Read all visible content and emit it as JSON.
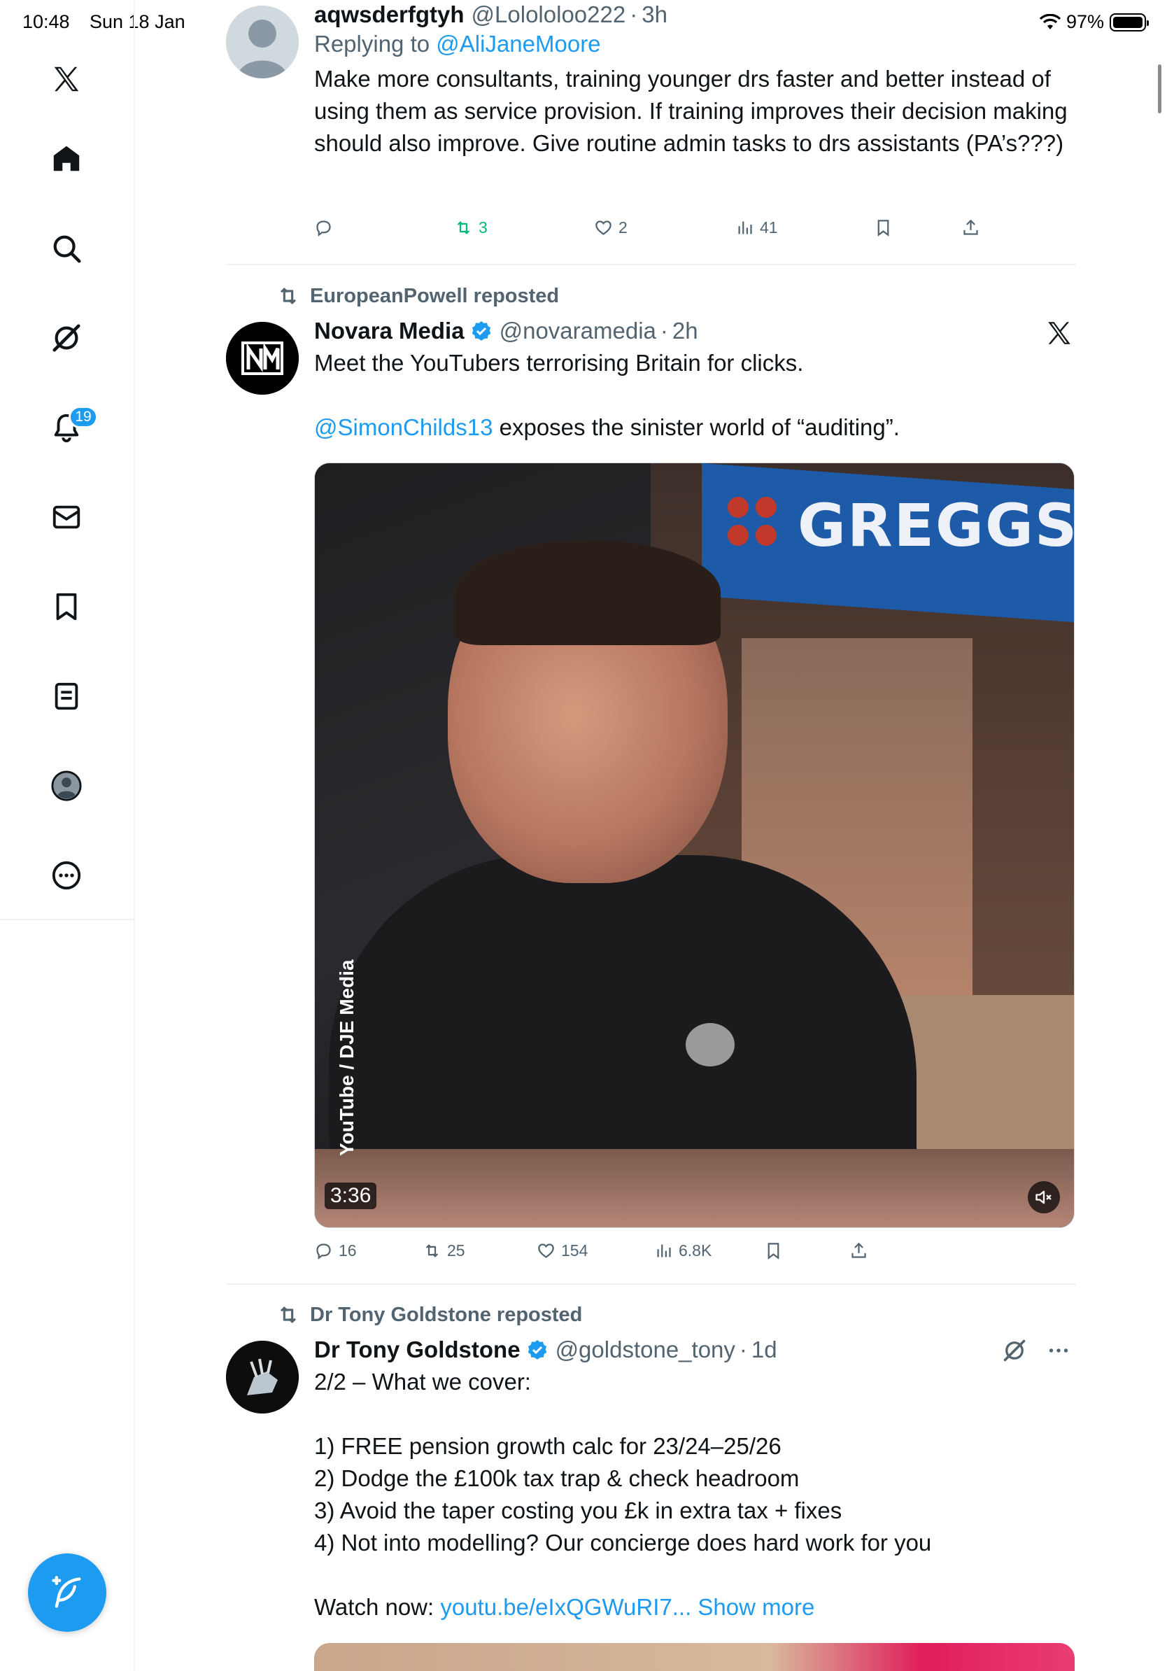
{
  "status_bar": {
    "time": "10:48",
    "date": "Sun 18 Jan",
    "battery": "97%"
  },
  "sidebar": {
    "items": [
      {
        "name": "x-logo-icon"
      },
      {
        "name": "home-icon"
      },
      {
        "name": "search-icon"
      },
      {
        "name": "grok-icon"
      },
      {
        "name": "notifications-icon",
        "badge": "19"
      },
      {
        "name": "messages-icon"
      },
      {
        "name": "bookmarks-icon"
      },
      {
        "name": "lists-icon"
      },
      {
        "name": "profile-avatar-icon"
      },
      {
        "name": "more-icon"
      }
    ],
    "compose_icon": "compose-feather-icon"
  },
  "tweets": [
    {
      "name": "aqwsderfgtyh",
      "handle": "@Lolololoo222",
      "time": "3h",
      "reply_prefix": "Replying to ",
      "reply_to": "@AliJaneMoore",
      "text": "Make more consultants, training younger drs faster and better instead of using them as service provision. If training improves their decision making should also improve. Give routine admin tasks to drs assistants (PA’s???)",
      "stats": {
        "replies": "",
        "reposts": "3",
        "likes": "2",
        "views": "41"
      }
    },
    {
      "reposted_by": "EuropeanPowell reposted",
      "name": "Novara Media",
      "handle": "@novaramedia",
      "time": "2h",
      "text_line1": "Meet the YouTubers terrorising Britain for clicks.",
      "mention": "@SimonChilds13",
      "text_line2": " exposes the sinister world of “auditing”.",
      "video": {
        "sign": "GREGGS",
        "credit": "YouTube / DJE Media",
        "duration": "3:36"
      },
      "stats": {
        "replies": "16",
        "reposts": "25",
        "likes": "154",
        "views": "6.8K"
      }
    },
    {
      "reposted_by": "Dr Tony Goldstone reposted",
      "name": "Dr Tony Goldstone",
      "handle": "@goldstone_tony",
      "time": "1d",
      "lines": [
        "2/2 – What we cover:",
        "",
        "1) FREE pension growth calc for 23/24–25/26",
        "2) Dodge the £100k tax trap & check headroom",
        "3) Avoid the taper costing you £k in extra tax + fixes",
        "4) Not into modelling? Our concierge does hard work for you",
        "",
        "Watch now: "
      ],
      "link": "youtu.be/eIxQGWuRI7...",
      "show_more": " Show more"
    }
  ],
  "colors": {
    "accent": "#1d9bf0",
    "repost_green": "#00ba7c",
    "muted": "#536471"
  }
}
